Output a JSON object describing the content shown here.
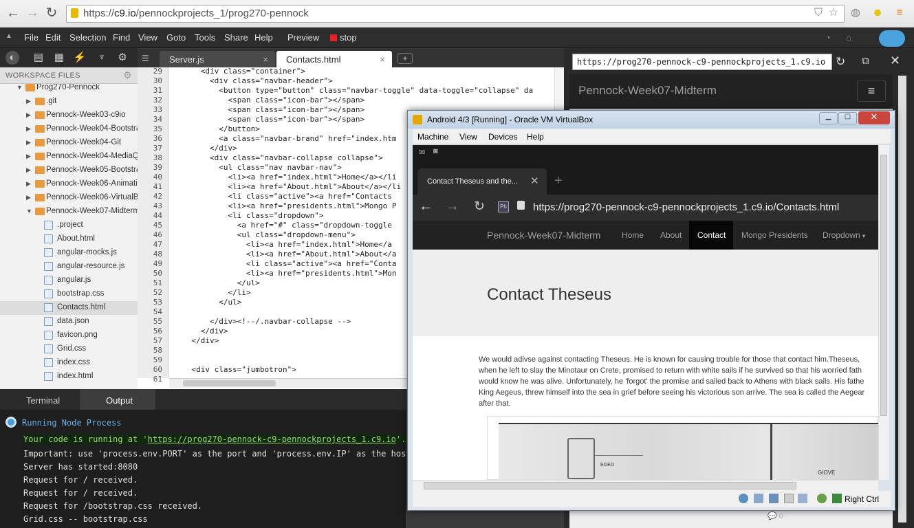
{
  "browser": {
    "url_protocol": "https://",
    "url_host": "c9.io",
    "url_path": "/pennockprojects_1/prog270-pennock"
  },
  "ide": {
    "menu": [
      "File",
      "Edit",
      "Selection",
      "Find",
      "View",
      "Goto",
      "Tools",
      "Share",
      "Help",
      "Preview",
      "stop"
    ],
    "tabs": [
      {
        "label": "Server.js",
        "active": false
      },
      {
        "label": "Contacts.html",
        "active": true
      }
    ],
    "add_tab": "+",
    "workspace_title": "WORKSPACE FILES",
    "tree": [
      {
        "label": "Prog270-Pennock",
        "type": "folder"
      },
      {
        "label": ".git",
        "type": "folder"
      },
      {
        "label": "Pennock-Week03-c9io",
        "type": "folder"
      },
      {
        "label": "Pennock-Week04-Bootstrap",
        "type": "folder"
      },
      {
        "label": "Pennock-Week04-Git",
        "type": "folder"
      },
      {
        "label": "Pennock-Week04-MediaQue",
        "type": "folder"
      },
      {
        "label": "Pennock-Week05-Bootstrap",
        "type": "folder"
      },
      {
        "label": "Pennock-Week06-Animation",
        "type": "folder"
      },
      {
        "label": "Pennock-Week06-VirtualBox",
        "type": "folder"
      },
      {
        "label": "Pennock-Week07-Midterm",
        "type": "folder"
      },
      {
        "label": ".project",
        "type": "file"
      },
      {
        "label": "About.html",
        "type": "file"
      },
      {
        "label": "angular-mocks.js",
        "type": "file"
      },
      {
        "label": "angular-resource.js",
        "type": "file"
      },
      {
        "label": "angular.js",
        "type": "file"
      },
      {
        "label": "bootstrap.css",
        "type": "file"
      },
      {
        "label": "Contacts.html",
        "type": "file"
      },
      {
        "label": "data.json",
        "type": "file"
      },
      {
        "label": "favicon.png",
        "type": "file"
      },
      {
        "label": "Grid.css",
        "type": "file"
      },
      {
        "label": "index.css",
        "type": "file"
      },
      {
        "label": "index.html",
        "type": "file"
      }
    ],
    "code": [
      {
        "n": "29",
        "t": "      <div class=\"container\">"
      },
      {
        "n": "30",
        "t": "        <div class=\"navbar-header\">"
      },
      {
        "n": "31",
        "t": "          <button type=\"button\" class=\"navbar-toggle\" data-toggle=\"collapse\" da"
      },
      {
        "n": "32",
        "t": "            <span class=\"icon-bar\"></span>"
      },
      {
        "n": "33",
        "t": "            <span class=\"icon-bar\"></span>"
      },
      {
        "n": "34",
        "t": "            <span class=\"icon-bar\"></span>"
      },
      {
        "n": "35",
        "t": "          </button>"
      },
      {
        "n": "36",
        "t": "          <a class=\"navbar-brand\" href=\"index.htm"
      },
      {
        "n": "37",
        "t": "        </div>"
      },
      {
        "n": "38",
        "t": "        <div class=\"navbar-collapse collapse\">"
      },
      {
        "n": "39",
        "t": "          <ul class=\"nav navbar-nav\">"
      },
      {
        "n": "40",
        "t": "            <li><a href=\"index.html\">Home</a></li"
      },
      {
        "n": "41",
        "t": "            <li><a href=\"About.html\">About</a></li"
      },
      {
        "n": "42",
        "t": "            <li class=\"active\"><a href=\"Contacts"
      },
      {
        "n": "43",
        "t": "            <li><a href=\"presidents.html\">Mongo P"
      },
      {
        "n": "44",
        "t": "            <li class=\"dropdown\">"
      },
      {
        "n": "45",
        "t": "              <a href=\"#\" class=\"dropdown-toggle"
      },
      {
        "n": "46",
        "t": "              <ul class=\"dropdown-menu\">"
      },
      {
        "n": "47",
        "t": "                <li><a href=\"index.html\">Home</a"
      },
      {
        "n": "48",
        "t": "                <li><a href=\"About.html\">About</a"
      },
      {
        "n": "49",
        "t": "                <li class=\"active\"><a href=\"Conta"
      },
      {
        "n": "50",
        "t": "                <li><a href=\"presidents.html\">Mon"
      },
      {
        "n": "51",
        "t": "              </ul>"
      },
      {
        "n": "52",
        "t": "            </li>"
      },
      {
        "n": "53",
        "t": "          </ul>"
      },
      {
        "n": "54",
        "t": ""
      },
      {
        "n": "55",
        "t": "        </div><!--/.navbar-collapse -->"
      },
      {
        "n": "56",
        "t": "      </div>"
      },
      {
        "n": "57",
        "t": "    </div>"
      },
      {
        "n": "58",
        "t": ""
      },
      {
        "n": "59",
        "t": ""
      },
      {
        "n": "60",
        "t": "    <div class=\"jumbotron\">"
      },
      {
        "n": "61",
        "t": ""
      }
    ],
    "bottom_tabs": [
      "Terminal",
      "Output"
    ],
    "terminal": {
      "process": "Running Node Process",
      "line1_prefix": "Your code is running at '",
      "line1_url": "https://prog270-pennock-c9-pennockprojects_1.c9.io",
      "line1_suffix": "'.",
      "lines": [
        "Important: use 'process.env.PORT' as the port and 'process.env.IP' as the host i",
        "Server has started:8080",
        "Request for / received.",
        "Request for / received.",
        "Request for /bootstrap.css received.",
        "Grid.css -- bootstrap.css"
      ]
    }
  },
  "preview": {
    "url": "https://prog270-pennock-c9-pennockprojects_1.c9.io",
    "brand": "Pennock-Week07-Midterm"
  },
  "virtualbox": {
    "title": "Android 4/3 [Running] - Oracle VM VirtualBox",
    "menu": [
      "Machine",
      "View",
      "Devices",
      "Help"
    ],
    "host_key": "Right Ctrl",
    "android": {
      "tab_title": "Contact Theseus and the...",
      "url": "https://prog270-pennock-c9-pennockprojects_1.c9.io/Contacts.html",
      "brand": "Pennock-Week07-Midterm",
      "nav": [
        "Home",
        "About",
        "Contact",
        "Mongo Presidents",
        "Dropdown"
      ],
      "heading": "Contact Theseus",
      "paragraph": [
        "We would adivse against contacting Theseus. He is known for causing trouble for those that contact him.Theseus,",
        "when he left to slay the Minotaur on Crete, promised to return with white sails if he survived so that his worried fath",
        "would know he was alive. Unfortunately, he 'forgot' the promise and sailed back to Athens with black sails. His fathe",
        "King Aegeus, threw himself into the sea in grief before seeing his victorious son arrive. The sea is called the Aegear",
        "after that."
      ],
      "sketch_labels": [
        "EGEO",
        "GIOVE"
      ]
    }
  },
  "comment_count": "0"
}
